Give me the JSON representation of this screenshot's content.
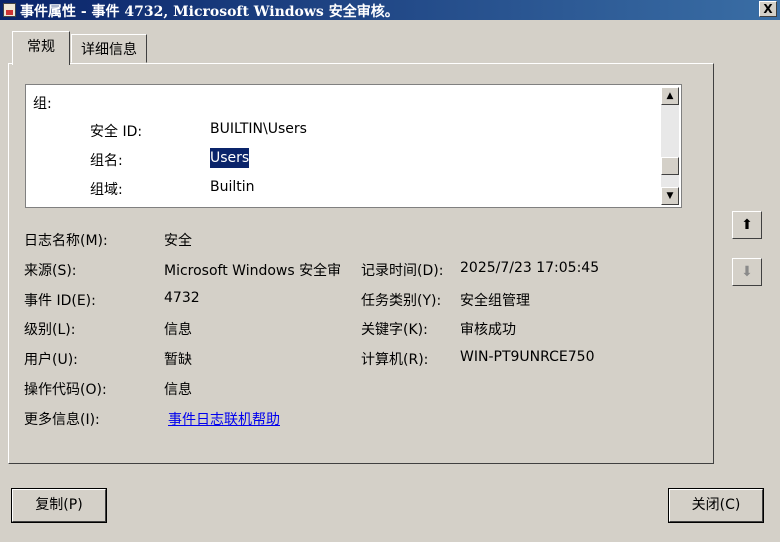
{
  "window": {
    "title": "事件属性 - 事件 4732, Microsoft Windows 安全审核。",
    "close_label": "X"
  },
  "tabs": [
    {
      "label": "常规",
      "active": true
    },
    {
      "label": "详细信息",
      "active": false
    }
  ],
  "description": {
    "group_header": "组:",
    "rows": [
      {
        "label": "安全 ID:",
        "value": "BUILTIN\\Users"
      },
      {
        "label": "组名:",
        "value": "Users"
      },
      {
        "label": "组域:",
        "value": "Builtin"
      }
    ]
  },
  "fields": {
    "log_name": {
      "label": "日志名称(M):",
      "value": "安全"
    },
    "source": {
      "label": "来源(S):",
      "value": "Microsoft Windows 安全审"
    },
    "logged": {
      "label": "记录时间(D):",
      "value": "2025/7/23 17:05:45"
    },
    "event_id": {
      "label": "事件 ID(E):",
      "value": "4732"
    },
    "task_category": {
      "label": "任务类别(Y):",
      "value": "安全组管理"
    },
    "level": {
      "label": "级别(L):",
      "value": "信息"
    },
    "keywords": {
      "label": "关键字(K):",
      "value": "审核成功"
    },
    "user": {
      "label": "用户(U):",
      "value": "暂缺"
    },
    "computer": {
      "label": "计算机(R):",
      "value": "WIN-PT9UNRCE750"
    },
    "opcode": {
      "label": "操作代码(O):",
      "value": "信息"
    },
    "more_info": {
      "label": "更多信息(I):",
      "value": "事件日志联机帮助"
    }
  },
  "buttons": {
    "copy": "复制(P)",
    "close": "关闭(C)"
  },
  "icons": {
    "up": "arrow-up-icon",
    "down": "arrow-down-icon"
  }
}
